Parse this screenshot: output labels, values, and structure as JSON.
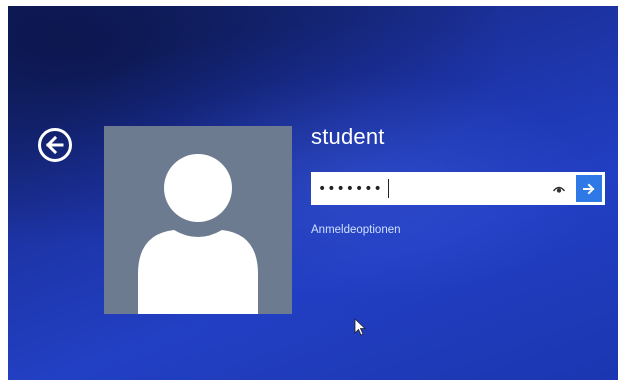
{
  "user": {
    "name": "student"
  },
  "password": {
    "value": "•••••••"
  },
  "links": {
    "signin_options": "Anmeldeoptionen"
  },
  "icons": {
    "back": "back-arrow-icon",
    "reveal": "eye-icon",
    "submit": "arrow-right-icon",
    "avatar": "user-avatar-icon",
    "cursor": "mouse-pointer-icon"
  },
  "colors": {
    "background": "#1d34a6",
    "avatar_bg": "#6d7b91",
    "submit_button": "#2e79e6",
    "link_text": "#cfe0ff"
  }
}
